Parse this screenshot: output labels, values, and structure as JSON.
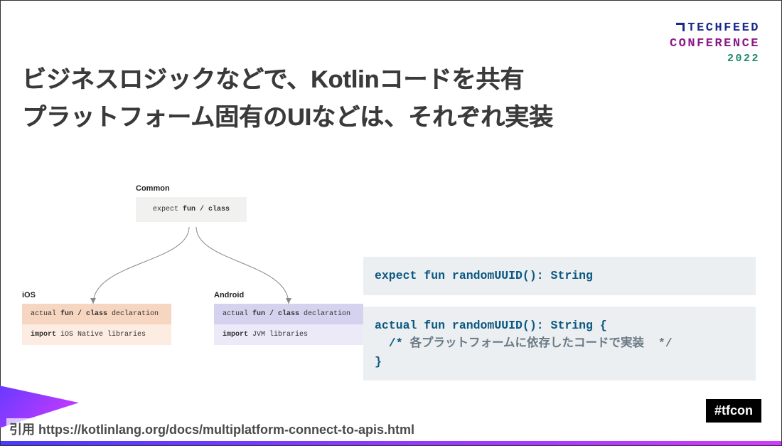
{
  "brand": {
    "line1": "TECHFEED",
    "line2": "CONFERENCE",
    "year": "2022"
  },
  "title": {
    "line1": "ビジネスロジックなどで、Kotlinコードを共有",
    "line2": "プラットフォーム固有のUIなどは、それぞれ実装"
  },
  "diagram": {
    "common": {
      "label": "Common",
      "box": "expect fun / class"
    },
    "ios": {
      "label": "iOS",
      "row1_pre": "actual ",
      "row1_kw": "fun / class",
      "row1_post": " declaration",
      "row2_pre": "import ",
      "row2_rest": "iOS Native libraries"
    },
    "android": {
      "label": "Android",
      "row1_pre": "actual ",
      "row1_kw": "fun / class",
      "row1_post": " declaration",
      "row2_pre": "import ",
      "row2_rest": "JVM libraries"
    }
  },
  "code": {
    "block1": "expect fun randomUUID(): String",
    "block2_l1": "actual fun randomUUID(): String {",
    "block2_l2_pre": "  /* ",
    "block2_l2_cmt": "各プラットフォームに依存したコードで実装  */",
    "block2_l3": "}"
  },
  "citation": "引用 https://kotlinlang.org/docs/multiplatform-connect-to-apis.html",
  "hashtag": "#tfcon"
}
